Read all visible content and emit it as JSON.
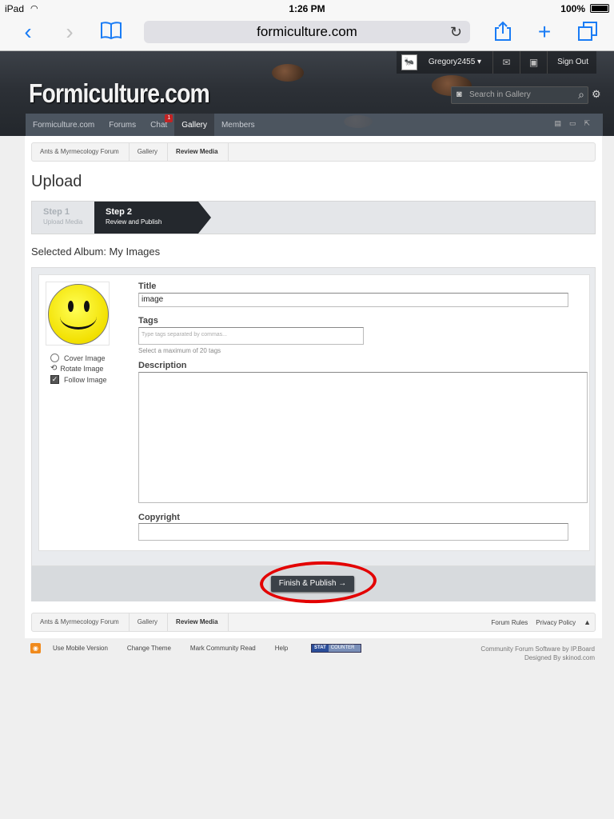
{
  "status": {
    "device": "iPad",
    "time": "1:26 PM",
    "battery": "100%"
  },
  "browser": {
    "url": "formiculture.com"
  },
  "site": {
    "logo": "Formiculture.com",
    "username": "Gregory2455 ▾",
    "signout": "Sign Out",
    "search_placeholder": "Search in Gallery",
    "nav": [
      {
        "label": "Formiculture.com"
      },
      {
        "label": "Forums"
      },
      {
        "label": "Chat",
        "badge": "1"
      },
      {
        "label": "Gallery"
      },
      {
        "label": "Members"
      }
    ]
  },
  "breadcrumbs": [
    "Ants & Myrmecology Forum",
    "Gallery",
    "Review Media"
  ],
  "page": {
    "title": "Upload",
    "step1_num": "Step 1",
    "step1_desc": "Upload Media",
    "step2_num": "Step 2",
    "step2_desc": "Review and Publish",
    "album": "Selected Album: My Images"
  },
  "editor": {
    "cover_label": "Cover Image",
    "rotate_label": "Rotate Image",
    "follow_label": "Follow Image",
    "title_label": "Title",
    "title_value": "image",
    "tags_label": "Tags",
    "tags_placeholder": "Type tags separated by commas...",
    "tags_hint": "Select a maximum of 20 tags",
    "description_label": "Description",
    "copyright_label": "Copyright"
  },
  "submit": {
    "label": "Finish & Publish →"
  },
  "bottom": {
    "forum_rules": "Forum Rules",
    "privacy": "Privacy Policy"
  },
  "footer": {
    "links": [
      "Use Mobile Version",
      "Change Theme",
      "Mark Community Read",
      "Help"
    ],
    "stat_a": "STAT",
    "stat_b": "COUNTER",
    "credit1": "Community Forum Software by IP.Board",
    "credit2": "Designed By skinod.com"
  },
  "colors": {
    "ios_blue": "#1a7cf5",
    "annotation_red": "#e30000",
    "header_dark": "#2c3036"
  }
}
